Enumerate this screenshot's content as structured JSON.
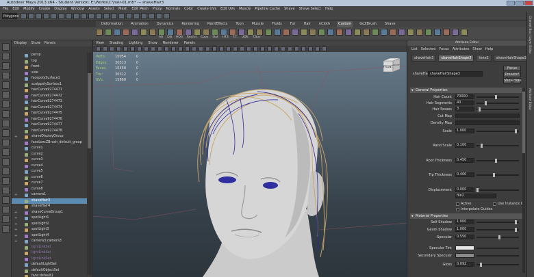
{
  "window": {
    "title": "Autodesk Maya 2013 x64 - Student Version: E:\\Works\\C:\\hair-01.mb* --- shaveHair3"
  },
  "menubar": [
    "File",
    "Edit",
    "Modify",
    "Create",
    "Display",
    "Window",
    "Assets",
    "Select",
    "Mesh",
    "Edit Mesh",
    "Proxy",
    "Normals",
    "Color",
    "Create UVs",
    "Edit UVs",
    "Muscle",
    "Pipeline Cache",
    "Shave",
    "Shave Select",
    "Help"
  ],
  "status_line": {
    "mode": "Polygons"
  },
  "shelf": {
    "tabs": [
      "Deformation",
      "Animation",
      "Dynamics",
      "Rendering",
      "PaintEffects",
      "Toon",
      "Muscle",
      "Fluids",
      "Fur",
      "Hair",
      "nCloth",
      "Custom",
      "GoZBrush",
      "Shave"
    ],
    "active_tab": "Custom",
    "labels": [
      "AR",
      "DN",
      "HO3",
      "Round",
      "Copy",
      "Out",
      "HT3",
      "T.T.",
      "UDK",
      "T.Sov"
    ]
  },
  "outliner": {
    "menu": [
      "Display",
      "Show",
      "Panels"
    ],
    "items": [
      {
        "label": "persp",
        "state": "normal"
      },
      {
        "label": "top",
        "state": "normal"
      },
      {
        "label": "front",
        "state": "normal"
      },
      {
        "label": "side",
        "state": "normal"
      },
      {
        "label": "facepolySurface1",
        "state": "normal"
      },
      {
        "label": "scalppolySurface1",
        "state": "normal"
      },
      {
        "label": "hairCurve9274471",
        "state": "normal"
      },
      {
        "label": "hairCurve9274472",
        "state": "normal"
      },
      {
        "label": "hairCurve9274473",
        "state": "normal"
      },
      {
        "label": "hairCurve9274474",
        "state": "normal"
      },
      {
        "label": "hairCurve9274475",
        "state": "normal"
      },
      {
        "label": "hairCurve9274476",
        "state": "normal"
      },
      {
        "label": "hairCurve9274477",
        "state": "normal"
      },
      {
        "label": "hairCurve9274478",
        "state": "normal"
      },
      {
        "label": "shaveDisplayGroup",
        "state": "expandable"
      },
      {
        "label": "faceLow:ZBrush_default_group",
        "state": "normal"
      },
      {
        "label": "curve1",
        "state": "normal"
      },
      {
        "label": "curve2",
        "state": "normal"
      },
      {
        "label": "curve3",
        "state": "normal"
      },
      {
        "label": "curve4",
        "state": "normal"
      },
      {
        "label": "curve5",
        "state": "normal"
      },
      {
        "label": "curve6",
        "state": "normal"
      },
      {
        "label": "curve7",
        "state": "normal"
      },
      {
        "label": "curve8",
        "state": "normal"
      },
      {
        "label": "camera1",
        "state": "expandable"
      },
      {
        "label": "shaveHair3",
        "state": "selected"
      },
      {
        "label": "shaveHair4",
        "state": "normal"
      },
      {
        "label": "shaveCurveGroup1",
        "state": "expandable"
      },
      {
        "label": "spotLight1",
        "state": "expandable"
      },
      {
        "label": "spotLight2",
        "state": "expandable"
      },
      {
        "label": "spotLight3",
        "state": "expandable"
      },
      {
        "label": "spotLight4",
        "state": "expandable"
      },
      {
        "label": "camera3:camera3",
        "state": "expandable"
      },
      {
        "label": "lightLinkSet",
        "state": "dim"
      },
      {
        "label": "lightLinkSet",
        "state": "dim"
      },
      {
        "label": "lightLinkSet",
        "state": "dim"
      },
      {
        "label": "defaultLightSet",
        "state": "normal"
      },
      {
        "label": "defaultObjectSet",
        "state": "normal"
      },
      {
        "label": "face:default1",
        "state": "normal"
      }
    ]
  },
  "viewport": {
    "menu": [
      "View",
      "Shading",
      "Lighting",
      "Show",
      "Renderer",
      "Panels"
    ],
    "hud": [
      {
        "label": "Verts:",
        "value": "15054",
        "extra": "0"
      },
      {
        "label": "Edges:",
        "value": "30513",
        "extra": "0"
      },
      {
        "label": "Faces:",
        "value": "15558",
        "extra": "0"
      },
      {
        "label": "Tris:",
        "value": "30312",
        "extra": "0"
      },
      {
        "label": "UVs:",
        "value": "15868",
        "extra": "0"
      }
    ],
    "viewcube": {
      "front": "FRONT",
      "right": "RIGHT"
    }
  },
  "attribute_editor": {
    "title": "Attribute Editor",
    "menu": [
      "List",
      "Selected",
      "Focus",
      "Attributes",
      "Show",
      "Help"
    ],
    "tabs": [
      "shaveHair3",
      "shaveHairShape3",
      "time1",
      "shaveHairShape3_growth"
    ],
    "active_tab": "shaveHairShape3",
    "node_label": "shaveHair:",
    "node_name": "shaveHairShape3",
    "focus_button": "Focus",
    "presets_button": "Presets*",
    "show_button": "Show",
    "hide_button": "Hide",
    "sections": {
      "general": "General Properties",
      "material": "Material Properties"
    },
    "general_props": [
      {
        "label": "Hair Count",
        "value": "70000",
        "slider": 0.45
      },
      {
        "label": "Hair Segments",
        "value": "40",
        "slider": 0.2
      },
      {
        "label": "Hair Passes",
        "value": "3",
        "slider": 0.05
      }
    ],
    "cut_map_label": "Cut Map",
    "density_map_label": "Density Map",
    "scale": {
      "label": "Scale",
      "value": "1.000",
      "slider": 0.95
    },
    "rand_scale": {
      "label": "Rand Scale",
      "value": "0.100",
      "slider": 0.1
    },
    "root_thickness": {
      "label": "Root Thickness",
      "value": "0.450",
      "slider": 0.45
    },
    "tip_thickness": {
      "label": "Tip Thickness",
      "value": "0.400",
      "slider": 0.4
    },
    "displacement": {
      "label": "Displacement",
      "value": "0.000",
      "slider": 0.0
    },
    "display_as": "file2",
    "active_label": "Active",
    "use_instance_label": "Use Instance Of",
    "interpolate_label": "Interpolate Guides",
    "material_props": [
      {
        "label": "Self Shadow",
        "value": "1.000",
        "slider": 0.95
      },
      {
        "label": "Geom Shadow",
        "value": "1.000",
        "slider": 0.95
      },
      {
        "label": "Specular",
        "value": "0.550",
        "slider": 0.55
      }
    ],
    "specular_tint_label": "Specular Tint",
    "secondary_specular_label": "Secondary Specular",
    "gloss": {
      "label": "Gloss",
      "value": "0.092",
      "slider": 0.09
    }
  },
  "side_strip": [
    "Channel Box / Layer Editor",
    "Attribute Editor"
  ],
  "colors": {
    "selection": "#5b8bb0",
    "hud_label": "#9fd27d",
    "hair_blonde": "#c9a56a",
    "hair_blue": "#2c2a9a"
  }
}
